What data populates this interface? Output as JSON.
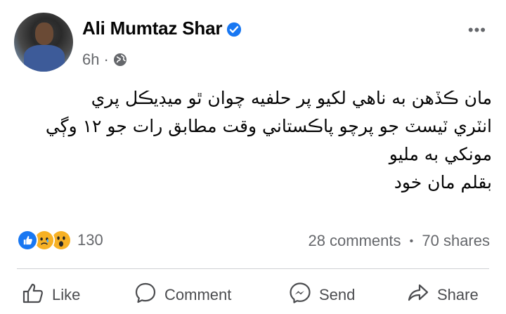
{
  "post": {
    "author": "Ali Mumtaz Shar",
    "verified": true,
    "time": "6h",
    "audience_icon": "globe-icon",
    "more_icon": "more-options-icon",
    "more_label": "•••",
    "text_lines": [
      "مان ڪڏهن به ناهي لکيو  پر حلفيه چوان ٿو ميڊيڪل پري",
      "انٽري  ٽيسٽ جو پرچو پاڪستاني وقت مطابق رات جو ١٢ وڳي",
      "مونکي به مليو",
      "بقلم مان خود"
    ]
  },
  "engagement": {
    "reaction_icons": [
      "like-icon",
      "sad-icon",
      "wow-icon"
    ],
    "reaction_count": "130",
    "comments": "28 comments",
    "separator": "•",
    "shares": "70 shares"
  },
  "actions": {
    "like": "Like",
    "comment": "Comment",
    "send": "Send",
    "share": "Share"
  },
  "colors": {
    "verified": "#1877f2",
    "like_blue": "#1877f2",
    "emoji_yellow": "#f7b125",
    "secondary_text": "#65676b"
  }
}
